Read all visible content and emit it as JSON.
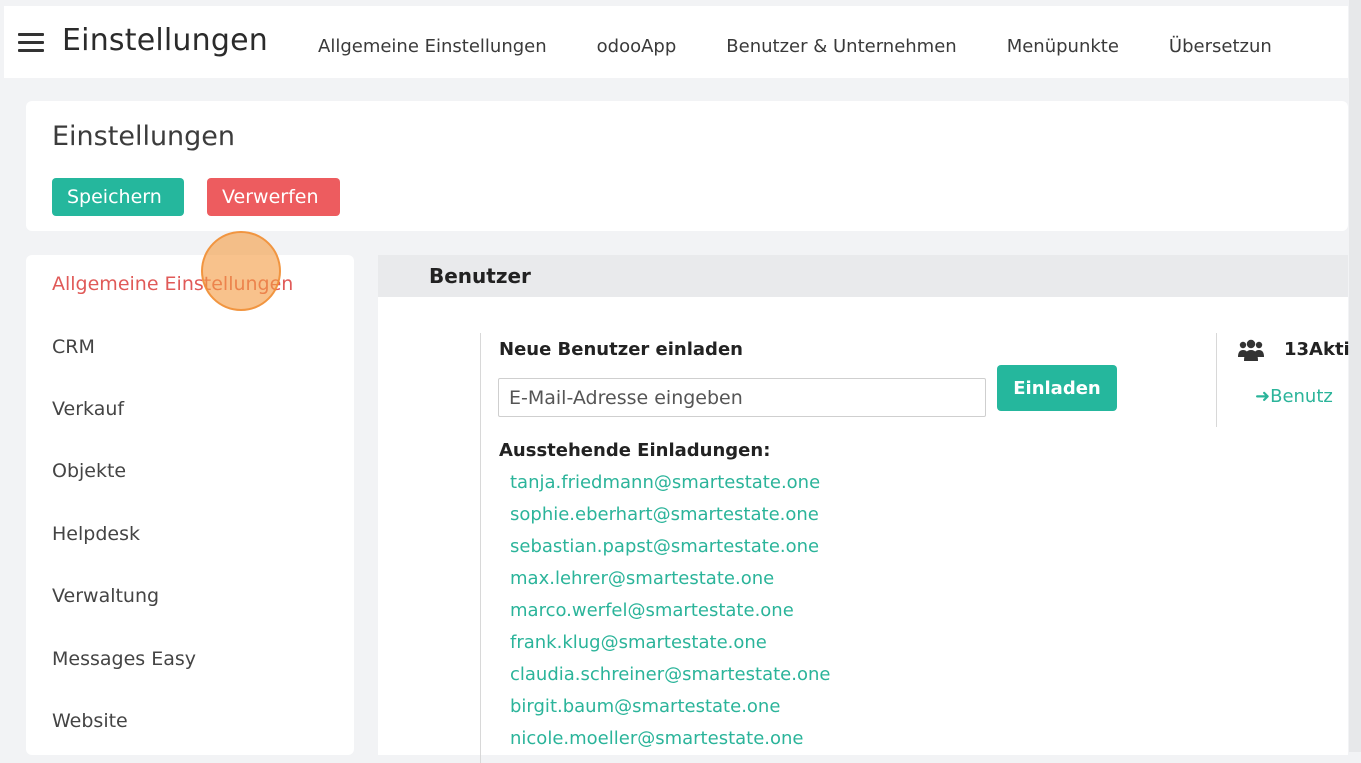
{
  "topbar": {
    "title": "Einstellungen",
    "menu": [
      {
        "label": "Allgemeine Einstellungen"
      },
      {
        "label": "odooApp"
      },
      {
        "label": "Benutzer & Unternehmen"
      },
      {
        "label": "Menüpunkte"
      },
      {
        "label": "Übersetzun"
      }
    ]
  },
  "header": {
    "title": "Einstellungen",
    "save_label": "Speichern",
    "discard_label": "Verwerfen"
  },
  "sidebar": {
    "items": [
      {
        "label": "Allgemeine Einstellungen",
        "active": true
      },
      {
        "label": "CRM"
      },
      {
        "label": "Verkauf"
      },
      {
        "label": "Objekte"
      },
      {
        "label": "Helpdesk"
      },
      {
        "label": "Verwaltung"
      },
      {
        "label": "Messages Easy"
      },
      {
        "label": "Website"
      }
    ]
  },
  "users_section": {
    "title": "Benutzer",
    "invite_label": "Neue Benutzer einladen",
    "email_placeholder": "E-Mail-Adresse eingeben",
    "invite_button": "Einladen",
    "pending_label": "Ausstehende Einladungen:",
    "pending": [
      "tanja.friedmann@smartestate.one",
      "sophie.eberhart@smartestate.one",
      "sebastian.papst@smartestate.one",
      "max.lehrer@smartestate.one",
      "marco.werfel@smartestate.one",
      "frank.klug@smartestate.one",
      "claudia.schreiner@smartestate.one",
      "birgit.baum@smartestate.one",
      "nicole.moeller@smartestate.one"
    ],
    "active_users": "13Akti",
    "manage_users_link": "Benutz"
  },
  "colors": {
    "primary": "#25b79d",
    "danger": "#ed5c5f",
    "link": "#2bb49a",
    "active_menu": "#e05a58"
  }
}
